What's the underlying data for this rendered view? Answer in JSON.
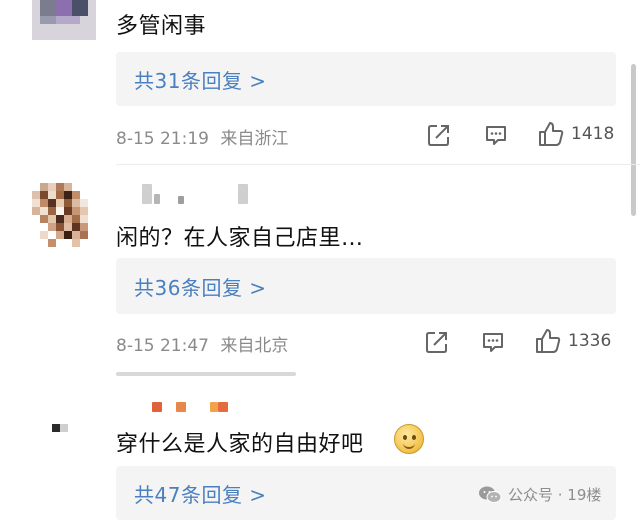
{
  "comments": [
    {
      "text": "多管闲事",
      "replies_label": "共31条回复 >",
      "timestamp": "8-15 21:19",
      "location": "来自浙江",
      "likes": "1418"
    },
    {
      "text": "闲的？在人家自己店里…",
      "replies_label": "共36条回复 >",
      "timestamp": "8-15 21:47",
      "location": "来自北京",
      "likes": "1336"
    },
    {
      "text": "穿什么是人家的自由好吧",
      "replies_label": "共47条回复 >",
      "emoji": "smiling-face-emoji"
    }
  ],
  "watermark": {
    "text": "公众号 · 19楼",
    "icon": "wechat-icon"
  },
  "colors": {
    "reply_link": "#4a7fc0",
    "meta_gray": "#8a8a8a",
    "reply_bg": "#f4f4f4"
  }
}
